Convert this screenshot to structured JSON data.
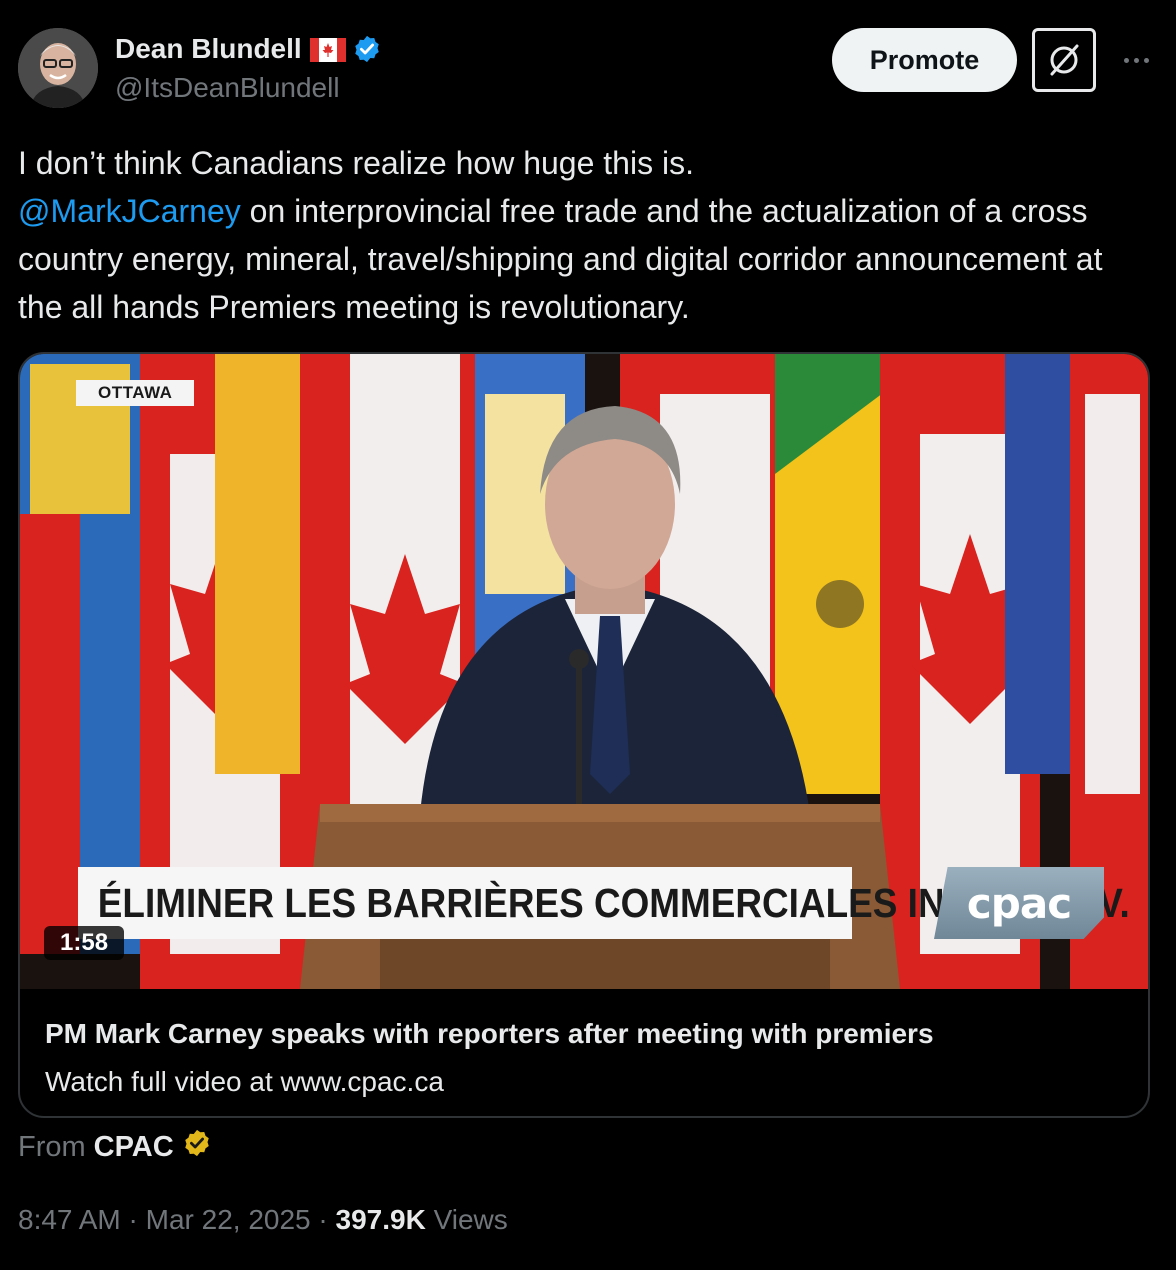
{
  "author": {
    "display_name": "Dean Blundell",
    "handle": "@ItsDeanBlundell",
    "flag_icon": "canada-flag-icon",
    "verified_color": "#1d9bf0"
  },
  "actions": {
    "promote_label": "Promote",
    "grok_icon": "grok-icon",
    "more_icon": "more-dots-icon"
  },
  "tweet": {
    "line1": "I don’t think Canadians realize how huge this is.",
    "mention": "@MarkJCarney",
    "rest": " on interprovincial free trade and the actualization of a cross country energy, mineral, travel/shipping and digital corridor announcement at the all hands Premiers meeting is revolutionary."
  },
  "video": {
    "location_tag": "OTTAWA",
    "banner_text": "ÉLIMINER LES BARRIÈRES COMMERCIALES INTERPROV.",
    "channel_logo": "cpac",
    "duration": "1:58"
  },
  "card": {
    "title": "PM Mark Carney speaks with reporters after meeting with premiers",
    "subtitle": "Watch full video at www.cpac.ca"
  },
  "source": {
    "prefix": "From",
    "name": "CPAC",
    "badge_color": "#e2b719"
  },
  "meta": {
    "time": "8:47 AM",
    "sep1": " · ",
    "date": "Mar 22, 2025",
    "sep2": " · ",
    "views_count": "397.9K",
    "views_label": " Views"
  },
  "colors": {
    "accent": "#1d9bf0",
    "muted": "#71767b",
    "text": "#e7e9ea",
    "background": "#000000"
  }
}
